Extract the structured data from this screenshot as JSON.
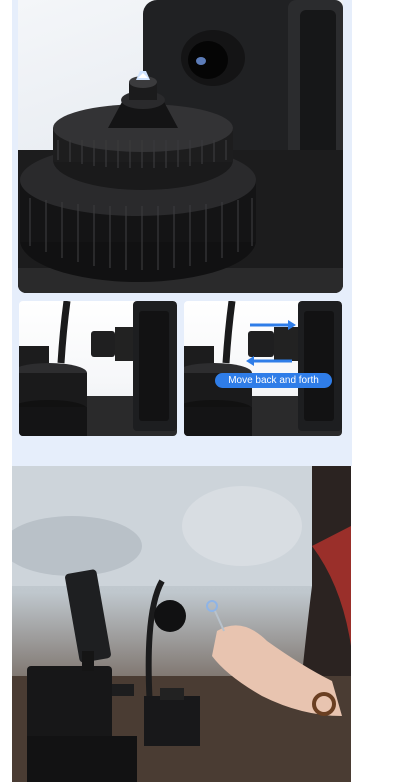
{
  "product_images": {
    "adjust_caption": "Move back and forth"
  }
}
